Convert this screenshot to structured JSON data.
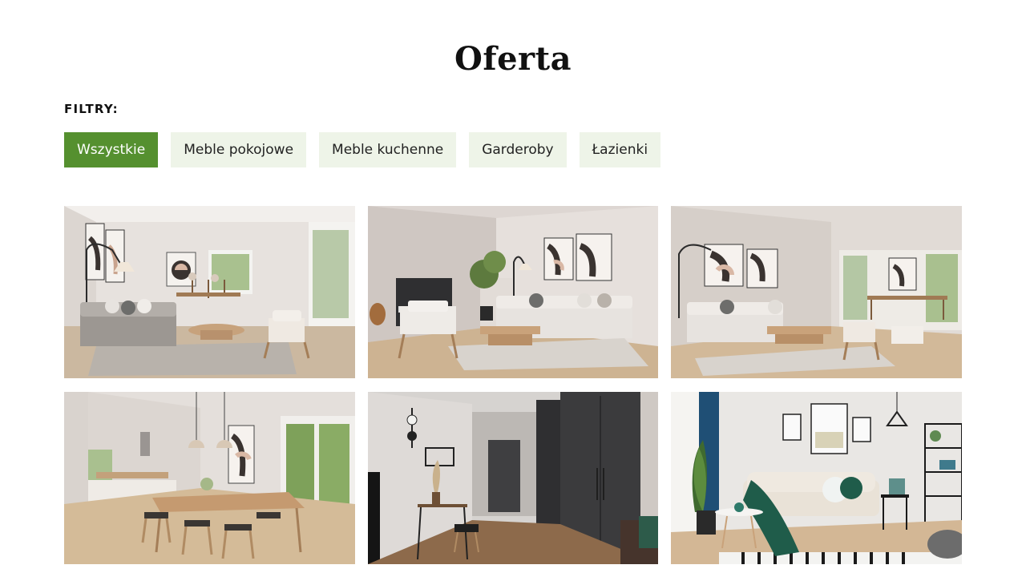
{
  "page": {
    "title": "Oferta"
  },
  "filters": {
    "label": "FILTRY:",
    "items": [
      {
        "label": "Wszystkie",
        "active": true
      },
      {
        "label": "Meble pokojowe",
        "active": false
      },
      {
        "label": "Meble kuchenne",
        "active": false
      },
      {
        "label": "Garderoby",
        "active": false
      },
      {
        "label": "Łazienki",
        "active": false
      }
    ]
  },
  "gallery": {
    "items": [
      {
        "subject": "living-room-with-sofa-and-dining-area"
      },
      {
        "subject": "living-room-with-piano-and-sofa"
      },
      {
        "subject": "open-living-room-with-dining-table"
      },
      {
        "subject": "dining-room-with-pendant-lamps"
      },
      {
        "subject": "hallway-with-wardrobe"
      },
      {
        "subject": "living-room-with-beige-sofa-and-plant"
      }
    ]
  },
  "colors": {
    "accent": "#55902f",
    "filter_inactive_bg": "#eef4e8"
  }
}
